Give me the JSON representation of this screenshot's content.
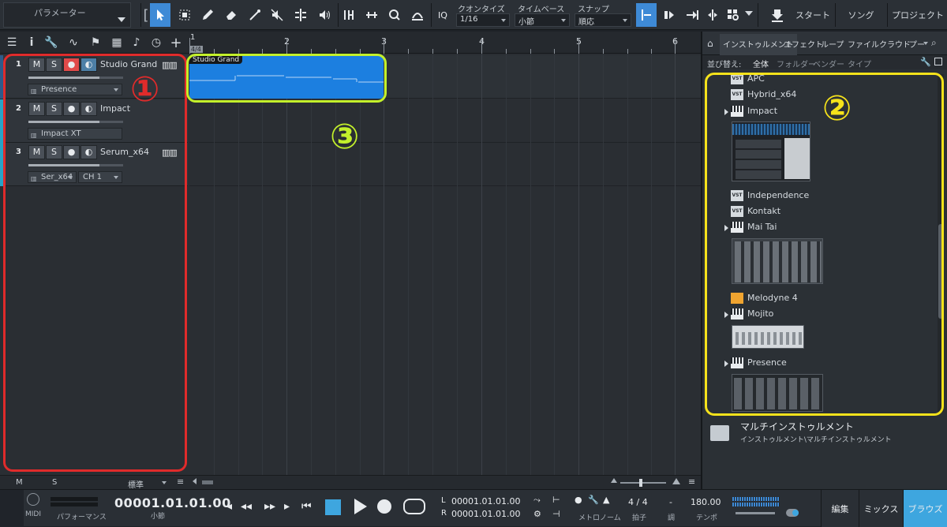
{
  "toolbar": {
    "parameter_label": "パラメーター",
    "quantize_label": "クオンタイズ",
    "quantize_value": "1/16",
    "timebase_label": "タイムベース",
    "timebase_value": "小節",
    "snap_label": "スナップ",
    "snap_value": "順応",
    "iq_label": "IQ",
    "start_label": "スタート",
    "song_label": "ソング",
    "project_label": "プロジェクト"
  },
  "tracks": [
    {
      "number": "1",
      "name": "Studio Grand",
      "instrument": "Presence",
      "channel": "",
      "color": "#3e8ad6"
    },
    {
      "number": "2",
      "name": "Impact",
      "instrument": "Impact XT",
      "channel": "",
      "color": "#27a3c6"
    },
    {
      "number": "3",
      "name": "Serum_x64",
      "instrument": "Ser_x64",
      "channel": "CH 1",
      "color": "#27a3c6"
    }
  ],
  "track_buttons": {
    "mute": "M",
    "solo": "S"
  },
  "track_footer": {
    "m": "M",
    "s": "S",
    "std": "標準"
  },
  "ruler": {
    "numbers": [
      "1",
      "2",
      "3",
      "4",
      "5",
      "6"
    ],
    "signature": "4/4"
  },
  "clip": {
    "name": "Studio Grand",
    "color": "#1c7fe0"
  },
  "browser": {
    "tabs": [
      "インストゥルメント",
      "エフェクト",
      "ループ",
      "ファイル",
      "クラウド",
      "プー"
    ],
    "sort_label": "並び替え:",
    "sort_options": [
      "全体",
      "フォルダー",
      "ベンダー",
      "タイプ"
    ],
    "items": [
      {
        "name": "APC",
        "icon": "vst-icon"
      },
      {
        "name": "Hybrid_x64",
        "icon": "vst-icon"
      },
      {
        "name": "Impact",
        "icon": "piano-icon"
      },
      {
        "name": "Independence",
        "icon": "vst-icon"
      },
      {
        "name": "Kontakt",
        "icon": "vst-icon"
      },
      {
        "name": "Mai Tai",
        "icon": "piano-icon"
      },
      {
        "name": "Melodyne 4",
        "icon": "melodyne-icon"
      },
      {
        "name": "Mojito",
        "icon": "piano-icon"
      },
      {
        "name": "Presence",
        "icon": "piano-icon"
      }
    ],
    "vst_badge": "VST",
    "multi_title": "マルチインストゥルメント",
    "multi_path": "インストゥルメント\\マルチインストゥルメント"
  },
  "transport": {
    "midi_label": "MIDI",
    "performance_label": "パフォーマンス",
    "time_main": "00001.01.01.00",
    "time_unit": "小節",
    "loop_l_label": "L",
    "loop_l": "00001.01.01.00",
    "loop_r_label": "R",
    "loop_r": "00001.01.01.00",
    "metronome_label": "メトロノーム",
    "signature": "4 / 4",
    "signature_label": "拍子",
    "key": "-",
    "key_label": "調",
    "tempo": "180.00",
    "tempo_label": "テンポ",
    "modes": [
      "編集",
      "ミックス",
      "ブラウズ"
    ]
  },
  "annotations": [
    {
      "number": "①",
      "color": "#e02b2b"
    },
    {
      "number": "②",
      "color": "#f5e21b"
    },
    {
      "number": "③",
      "color": "#c3f02b"
    }
  ]
}
